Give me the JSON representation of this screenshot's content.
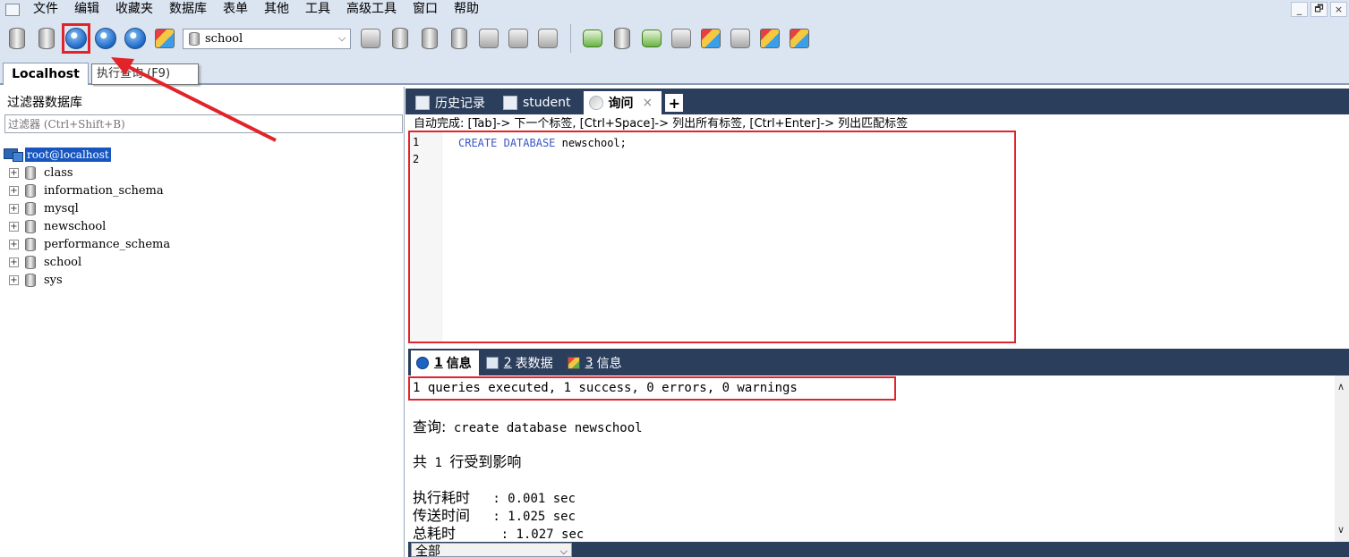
{
  "menu": [
    "文件",
    "编辑",
    "收藏夹",
    "数据库",
    "表单",
    "其他",
    "工具",
    "高级工具",
    "窗口",
    "帮助"
  ],
  "window_controls": [
    "_",
    "🗗",
    "×"
  ],
  "toolbar": {
    "database_select": "school",
    "execute_tooltip": "执行查询 (F9)"
  },
  "connection_tab": "Localhost",
  "left_pane": {
    "filter_title": "过滤器数据库",
    "filter_placeholder": "过滤器 (Ctrl+Shift+B)",
    "root": "root@localhost",
    "databases": [
      "class",
      "information_schema",
      "mysql",
      "newschool",
      "performance_schema",
      "school",
      "sys"
    ]
  },
  "editor_tabs": [
    {
      "label": "历史记录"
    },
    {
      "label": "student"
    },
    {
      "label": "询问",
      "close": "×"
    }
  ],
  "editor_tab_add": "+",
  "autocomplete_hint": "自动完成: [Tab]-> 下一个标签, [Ctrl+Space]-> 列出所有标签, [Ctrl+Enter]-> 列出匹配标签",
  "editor": {
    "line_numbers": [
      "1",
      "2"
    ],
    "code": {
      "kw1": "CREATE",
      "kw2": "DATABASE",
      "ident": "newschool;"
    }
  },
  "result_tabs": [
    {
      "num": "1",
      "label": "信息"
    },
    {
      "num": "2",
      "label": "表数据"
    },
    {
      "num": "3",
      "label": "信息"
    }
  ],
  "result": {
    "summary": "1 queries executed, 1 success, 0 errors, 0 warnings",
    "query_label": "查询:",
    "query_text": "create database newschool",
    "affected_prefix": "共",
    "affected_count": "1",
    "affected_suffix": "行受到影响",
    "exec_label": "执行耗时",
    "exec_value": ": 0.001 sec",
    "transfer_label": "传送时间",
    "transfer_value": ": 1.025 sec",
    "total_label": "总耗时",
    "total_value": ": 1.027 sec"
  },
  "scope_select": "全部",
  "colors": {
    "chrome": "#dbe4f1",
    "tab_dark": "#2b3e5c",
    "highlight_red": "#e0242a",
    "selection_blue": "#1756c0",
    "keyword": "#3a57c5"
  }
}
